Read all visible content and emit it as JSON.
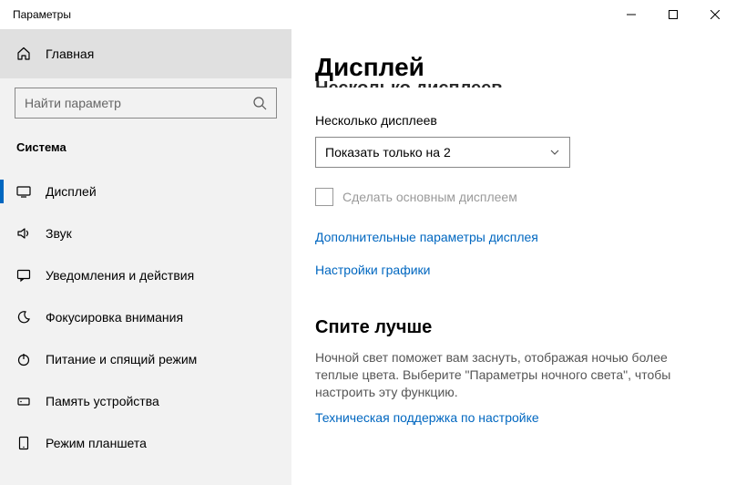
{
  "window": {
    "title": "Параметры"
  },
  "sidebar": {
    "home": "Главная",
    "search_placeholder": "Найти параметр",
    "category": "Система",
    "items": [
      {
        "label": "Дисплей"
      },
      {
        "label": "Звук"
      },
      {
        "label": "Уведомления и действия"
      },
      {
        "label": "Фокусировка внимания"
      },
      {
        "label": "Питание и спящий режим"
      },
      {
        "label": "Память устройства"
      },
      {
        "label": "Режим планшета"
      }
    ]
  },
  "main": {
    "page_title": "Дисплей",
    "cut_heading": "Несколько дисплеев",
    "multi_label": "Несколько дисплеев",
    "dropdown_value": "Показать только на 2",
    "checkbox_label": "Сделать основным дисплеем",
    "link_advanced": "Дополнительные параметры дисплея",
    "link_graphics": "Настройки графики",
    "sleep_title": "Спите лучше",
    "sleep_body": "Ночной свет поможет вам заснуть, отображая ночью более теплые цвета. Выберите \"Параметры ночного света\", чтобы настроить эту функцию.",
    "sleep_link": "Техническая поддержка по настройке"
  }
}
